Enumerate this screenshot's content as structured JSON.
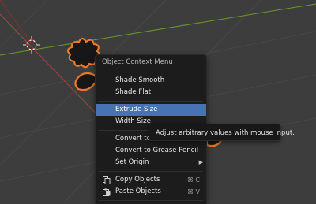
{
  "menu": {
    "title": "Object Context Menu",
    "items": [
      {
        "label": "Shade Smooth"
      },
      {
        "label": "Shade Flat"
      },
      {
        "label": "Extrude Size"
      },
      {
        "label": "Width Size"
      },
      {
        "label": "Convert to"
      },
      {
        "label": "Convert to Grease Pencil"
      },
      {
        "label": "Set Origin"
      },
      {
        "label": "Copy Objects",
        "shortcut": "⌘ C",
        "icon": "copy-icon"
      },
      {
        "label": "Paste Objects",
        "shortcut": "⌘ V",
        "icon": "paste-icon"
      }
    ],
    "active_item": "Extrude Size"
  },
  "tooltip": {
    "text": "Adjust arbitrary values with mouse input."
  },
  "colors": {
    "viewport_bg": "#3d3d3d",
    "menu_bg": "#1c1c1c",
    "highlight": "#4772b3",
    "selection_outline": "#e8792a",
    "x_axis": "#b04040",
    "y_axis": "#6a9a2a"
  }
}
